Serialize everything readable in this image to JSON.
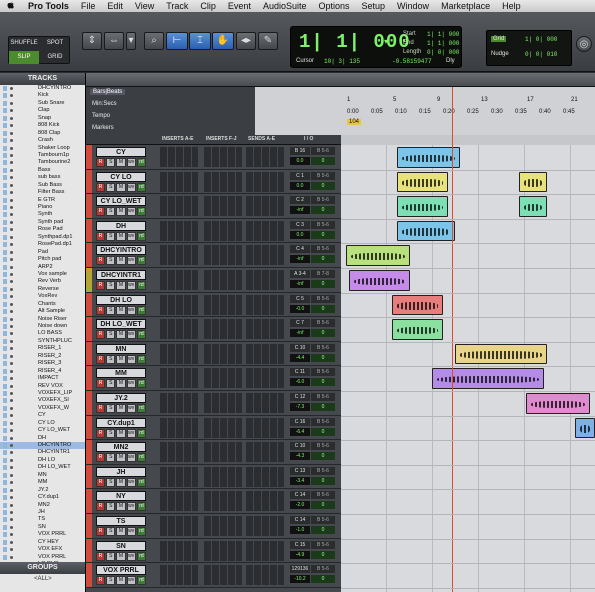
{
  "menubar": {
    "apple": "",
    "items": [
      "Pro Tools",
      "File",
      "Edit",
      "View",
      "Track",
      "Clip",
      "Event",
      "AudioSuite",
      "Options",
      "Setup",
      "Window",
      "Marketplace",
      "Help"
    ]
  },
  "toolbar": {
    "modes": [
      "SHUFFLE",
      "SPOT",
      "SLIP",
      "GRID"
    ],
    "counter_main": "1| 1| 000",
    "counter_start_label": "Start",
    "counter_end_label": "End",
    "counter_length_label": "Length",
    "counter_start": "1| 1| 000",
    "counter_end": "1| 1| 000",
    "counter_length": "0| 0| 000",
    "cursor_label": "Cursor",
    "cursor_value": "10| 3| 135",
    "cursor_level": "-0.58159477",
    "dly_label": "Dly",
    "grid_label": "Grid",
    "grid_value": "1| 0| 000",
    "nudge_label": "Nudge",
    "nudge_value": "0| 0| 010"
  },
  "tracks_panel": {
    "title": "TRACKS",
    "items": [
      "DHCYINTRO",
      "Kick",
      "Sub Snare",
      "Clap",
      "Snap",
      "808 Kick",
      "808 Clap",
      "Crash",
      "Shaker Loop",
      "Tambourn1p",
      "Tambourine2",
      "Bass",
      "sub bass",
      "Sub Bass",
      "Filter Bass",
      "E GTR",
      "Piano",
      "Synth",
      "Synth pad",
      "Rose Pad",
      "Synthpad.dp1",
      "RosePad.dp1",
      "Pad",
      "Pitch pad",
      "ARP2",
      "Vox sample",
      "Rev Verb",
      "Reverse",
      "VoxRev",
      "Chants",
      "Alt Sample",
      "Noise Riser",
      "Noise down",
      "LO BASS",
      "SYNTHPLUC",
      "RISER_1",
      "RISER_2",
      "RISER_3",
      "RISER_4",
      "IMPACT",
      "REV VOX",
      "VOXEFX_LIP",
      "VOXEFX_Sl",
      "VOXEFX_W",
      "CY",
      "CY LO",
      "CY LO_WET",
      "DH",
      "DHCYINTRO",
      "DHCYINTR1",
      "DH LO",
      "DH LO_WET",
      "MN",
      "MM",
      "JY.2",
      "CY.dup1",
      "MN2",
      "JH",
      "TS",
      "SN",
      "VOX PRRL",
      "CY HEY",
      "VOX EFX",
      "VOX PRRL",
      "LO DUB",
      "REV VOX.1",
      "add bgv",
      "ver dubs",
      "h bg",
      "Pre bgv",
      "lo dubs",
      "main bgv"
    ],
    "selected_index": 48
  },
  "groups_panel": {
    "title": "GROUPS",
    "all": "<ALL>"
  },
  "edit": {
    "rulers": [
      "Bars|Beats",
      "Min:Secs",
      "Tempo",
      "Markers"
    ],
    "tempo": "104",
    "bar_ticks": [
      "1",
      "5",
      "9",
      "13",
      "17",
      "21"
    ],
    "min_ticks": [
      "0:00",
      "0:05",
      "0:10",
      "0:15",
      "0:20",
      "0:25",
      "0:30",
      "0:35",
      "0:40",
      "0:45"
    ],
    "columns": [
      "INSERTS A-E",
      "INSERTS F-J",
      "SENDS A-E",
      "I / O"
    ]
  },
  "tracks": [
    {
      "name": "CY",
      "color": "#d24a3c",
      "io_in": "B 16",
      "io_out": "B 5-6",
      "vol": "0.0",
      "pan": "0"
    },
    {
      "name": "CY LO",
      "color": "#d24a3c",
      "io_in": "C 1",
      "io_out": "B 5-6",
      "vol": "0.0",
      "pan": "0"
    },
    {
      "name": "CY LO_WET",
      "color": "#d24a3c",
      "io_in": "C 2",
      "io_out": "B 5-6",
      "vol": "-inf",
      "pan": "0"
    },
    {
      "name": "DH",
      "color": "#d24a3c",
      "io_in": "C 3",
      "io_out": "B 5-6",
      "vol": "0.0",
      "pan": "0"
    },
    {
      "name": "DHCYINTRO",
      "color": "#d24a3c",
      "io_in": "C 4",
      "io_out": "B 5-6",
      "vol": "-inf",
      "pan": "0"
    },
    {
      "name": "DHCYINTR1",
      "color": "#b5a532",
      "io_in": "A 3-4",
      "io_out": "B 7-8",
      "vol": "-inf",
      "pan": "0"
    },
    {
      "name": "DH LO",
      "color": "#d24a3c",
      "io_in": "C 5",
      "io_out": "B 5-6",
      "vol": "-0.0",
      "pan": "0"
    },
    {
      "name": "DH LO_WET",
      "color": "#d24a3c",
      "io_in": "C 7",
      "io_out": "B 5-6",
      "vol": "-inf",
      "pan": "0"
    },
    {
      "name": "MN",
      "color": "#d24a3c",
      "io_in": "C 10",
      "io_out": "B 5-6",
      "vol": "-4.4",
      "pan": "0"
    },
    {
      "name": "MM",
      "color": "#d24a3c",
      "io_in": "C 11",
      "io_out": "B 5-6",
      "vol": "-6.0",
      "pan": "0"
    },
    {
      "name": "JY.2",
      "color": "#d24a3c",
      "io_in": "C 12",
      "io_out": "B 5-6",
      "vol": "-7.3",
      "pan": "0"
    },
    {
      "name": "CY.dup1",
      "color": "#d24a3c",
      "io_in": "C 16",
      "io_out": "B 5-6",
      "vol": "-6.4",
      "pan": "0"
    },
    {
      "name": "MN2",
      "color": "#d24a3c",
      "io_in": "C 10",
      "io_out": "B 5-6",
      "vol": "-4.3",
      "pan": "0"
    },
    {
      "name": "JH",
      "color": "#d24a3c",
      "io_in": "C 13",
      "io_out": "B 5-6",
      "vol": "-3.4",
      "pan": "0"
    },
    {
      "name": "NY",
      "color": "#d24a3c",
      "io_in": "C 14",
      "io_out": "B 5-6",
      "vol": "-2.0",
      "pan": "0"
    },
    {
      "name": "TS",
      "color": "#d24a3c",
      "io_in": "C 14",
      "io_out": "B 5-6",
      "vol": "-1.0",
      "pan": "0"
    },
    {
      "name": "SN",
      "color": "#d24a3c",
      "io_in": "C 15",
      "io_out": "B 5-6",
      "vol": "-4.9",
      "pan": "0"
    },
    {
      "name": "VOX PRRL",
      "color": "#d24a3c",
      "io_in": "129136",
      "io_out": "B 5-6",
      "vol": "-10.2",
      "pan": "0"
    }
  ],
  "track_buttons": {
    "rec": "R",
    "solo": "S",
    "mute": "M",
    "wave": "wv",
    "read": "rd"
  },
  "clips": [
    {
      "track": 0,
      "start": 0.22,
      "len": 0.25,
      "color": "#7dc5e8"
    },
    {
      "track": 1,
      "start": 0.22,
      "len": 0.2,
      "color": "#e8e27a"
    },
    {
      "track": 1,
      "start": 0.7,
      "len": 0.11,
      "color": "#e8e27a"
    },
    {
      "track": 2,
      "start": 0.22,
      "len": 0.2,
      "color": "#7de0b5"
    },
    {
      "track": 2,
      "start": 0.7,
      "len": 0.11,
      "color": "#7de0b5"
    },
    {
      "track": 3,
      "start": 0.22,
      "len": 0.23,
      "color": "#7dc5e8"
    },
    {
      "track": 4,
      "start": 0.02,
      "len": 0.25,
      "color": "#b8e07d"
    },
    {
      "track": 5,
      "start": 0.03,
      "len": 0.24,
      "color": "#c58be8"
    },
    {
      "track": 6,
      "start": 0.2,
      "len": 0.2,
      "color": "#e87d7d"
    },
    {
      "track": 7,
      "start": 0.2,
      "len": 0.2,
      "color": "#8be0a0"
    },
    {
      "track": 8,
      "start": 0.45,
      "len": 0.36,
      "color": "#e8d48b"
    },
    {
      "track": 9,
      "start": 0.36,
      "len": 0.44,
      "color": "#b58be8"
    },
    {
      "track": 10,
      "start": 0.73,
      "len": 0.25,
      "color": "#e08bd0"
    },
    {
      "track": 11,
      "start": 0.92,
      "len": 0.08,
      "color": "#7db0e8"
    }
  ]
}
